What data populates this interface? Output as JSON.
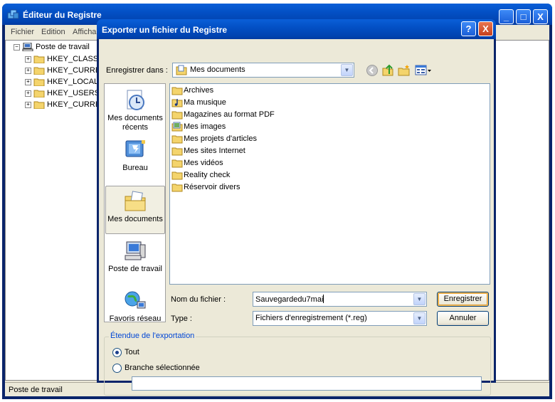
{
  "regedit": {
    "title": "Éditeur du Registre",
    "menu": [
      "Fichier",
      "Edition",
      "Afficha"
    ],
    "tree": {
      "root": "Poste de travail",
      "keys": [
        "HKEY_CLASS",
        "HKEY_CURRE",
        "HKEY_LOCAL",
        "HKEY_USERS",
        "HKEY_CURRE"
      ]
    },
    "status": "Poste de travail",
    "buttons": {
      "minimize": "_",
      "maximize": "□",
      "close": "X"
    }
  },
  "dialog": {
    "title": "Exporter un fichier du Registre",
    "help": "?",
    "close": "X",
    "save_in_label": "Enregistrer dans :",
    "save_in_value": "Mes documents",
    "places": [
      {
        "label": "Mes documents récents",
        "icon": "recent-documents-icon"
      },
      {
        "label": "Bureau",
        "icon": "desktop-icon"
      },
      {
        "label": "Mes documents",
        "icon": "my-documents-icon",
        "active": true
      },
      {
        "label": "Poste de travail",
        "icon": "my-computer-icon"
      },
      {
        "label": "Favoris réseau",
        "icon": "network-places-icon"
      }
    ],
    "files": [
      {
        "name": "Archives",
        "icon": "folder-icon"
      },
      {
        "name": "Ma musique",
        "icon": "music-folder-icon"
      },
      {
        "name": "Magazines au format PDF",
        "icon": "folder-icon"
      },
      {
        "name": "Mes images",
        "icon": "pictures-folder-icon"
      },
      {
        "name": "Mes projets d'articles",
        "icon": "folder-icon"
      },
      {
        "name": "Mes sites Internet",
        "icon": "folder-icon"
      },
      {
        "name": "Mes vidéos",
        "icon": "folder-icon"
      },
      {
        "name": "Reality check",
        "icon": "folder-icon"
      },
      {
        "name": "Réservoir divers",
        "icon": "folder-icon"
      }
    ],
    "filename_label": "Nom du fichier :",
    "filename_value": "Sauvegardedu7mai",
    "type_label": "Type :",
    "type_value": "Fichiers d'enregistrement (*.reg)",
    "save_button": "Enregistrer",
    "cancel_button": "Annuler",
    "scope": {
      "legend": "Étendue de l'exportation",
      "all_label": "Tout",
      "branch_label": "Branche sélectionnée",
      "branch_value": "",
      "selected": "all"
    }
  }
}
